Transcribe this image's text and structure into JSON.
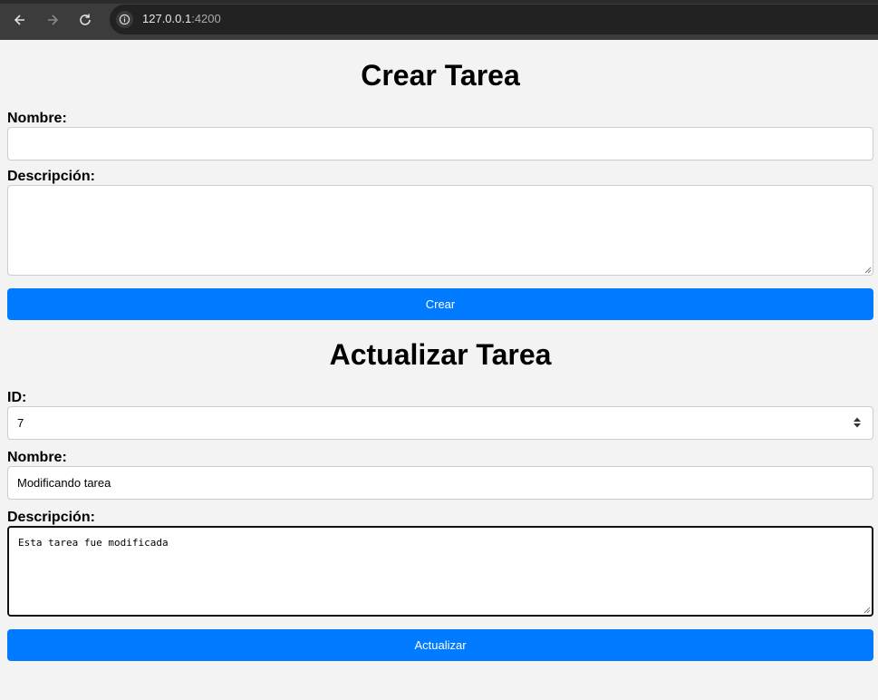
{
  "browser": {
    "url_host": "127.0.0.1",
    "url_port": ":4200"
  },
  "create": {
    "title": "Crear Tarea",
    "name_label": "Nombre:",
    "name_value": "",
    "description_label": "Descripción:",
    "description_value": "",
    "submit_label": "Crear"
  },
  "update": {
    "title": "Actualizar Tarea",
    "id_label": "ID:",
    "id_value": "7",
    "name_label": "Nombre:",
    "name_value": "Modificando tarea",
    "description_label": "Descripción:",
    "description_value": "Esta tarea fue modificada",
    "submit_label": "Actualizar"
  },
  "colors": {
    "button_bg": "#007bff",
    "page_bg": "#f3f3f3"
  }
}
